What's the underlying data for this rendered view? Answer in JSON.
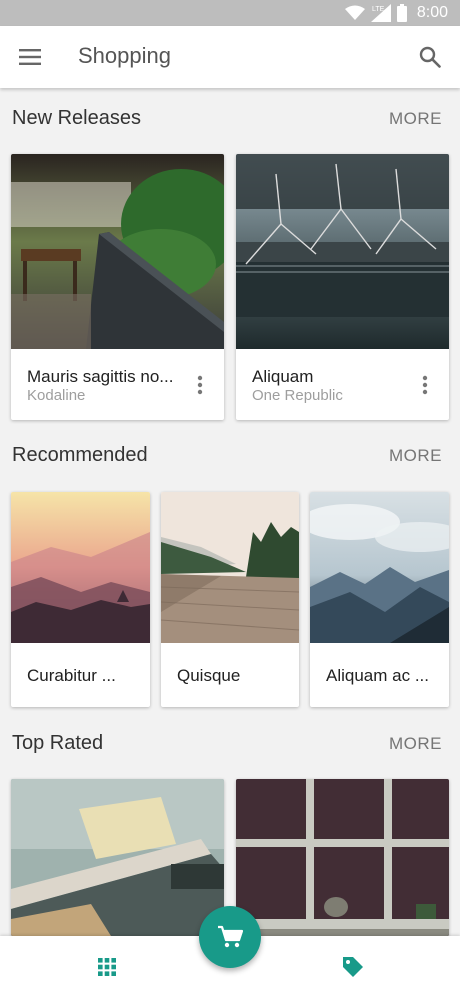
{
  "status_bar": {
    "time": "8:00",
    "network": "LTE",
    "icons": [
      "wifi-icon",
      "signal-icon",
      "battery-icon"
    ]
  },
  "app_bar": {
    "title": "Shopping",
    "menu_icon": "menu-icon",
    "search_icon": "search-icon"
  },
  "sections": {
    "new_releases": {
      "title": "New Releases",
      "more": "MORE",
      "items": [
        {
          "title": "Mauris sagittis no...",
          "subtitle": "Kodaline"
        },
        {
          "title": "Aliquam",
          "subtitle": "One Republic"
        }
      ]
    },
    "recommended": {
      "title": "Recommended",
      "more": "MORE",
      "items": [
        {
          "title": "Curabitur ..."
        },
        {
          "title": "Quisque"
        },
        {
          "title": "Aliquam ac ..."
        }
      ]
    },
    "top_rated": {
      "title": "Top Rated",
      "more": "MORE",
      "items": []
    }
  },
  "bottom_nav": {
    "left_icon": "apps-grid-icon",
    "fab_icon": "cart-icon",
    "right_icon": "tag-icon"
  },
  "colors": {
    "accent": "#189a89",
    "status_bar": "#bdbdbd",
    "background": "#f2f2f2"
  }
}
